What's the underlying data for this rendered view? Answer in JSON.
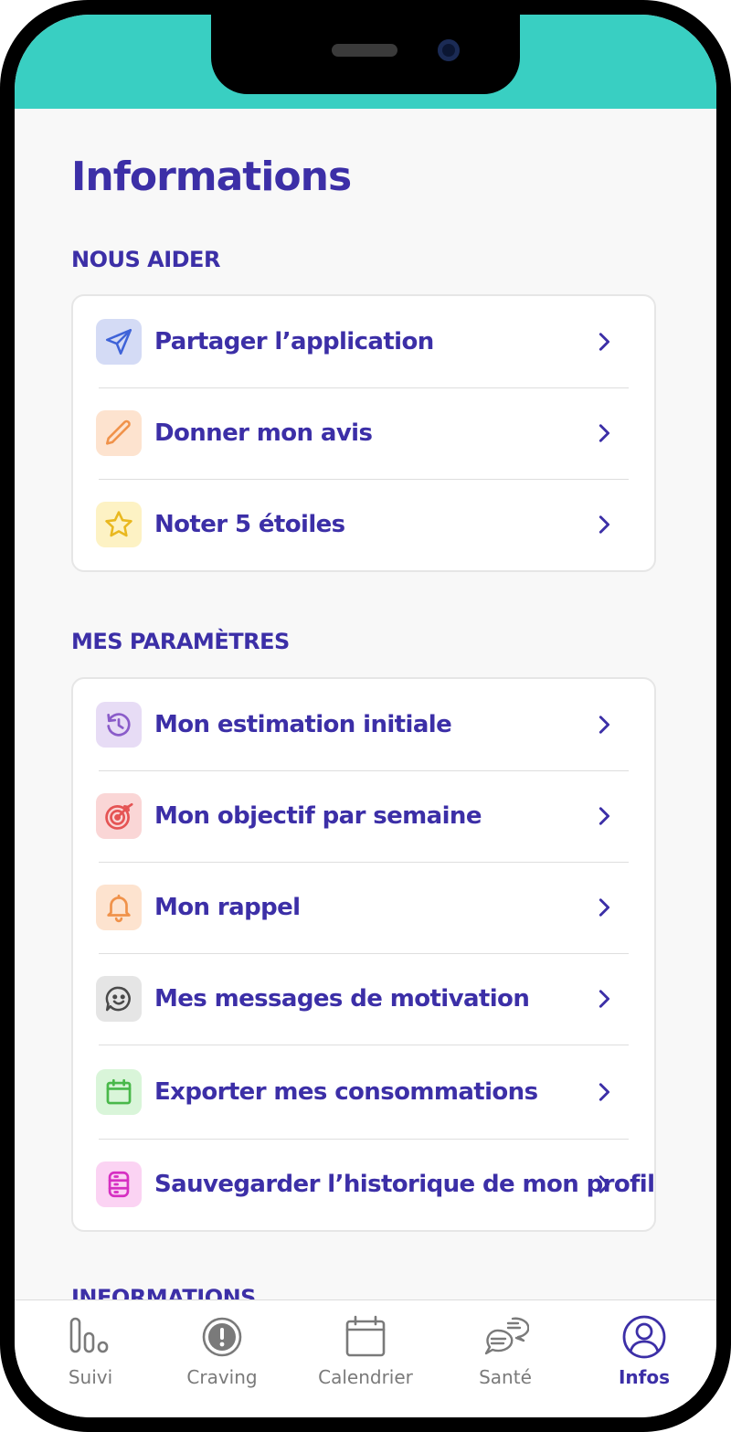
{
  "page": {
    "title": "Informations"
  },
  "sections": [
    {
      "title": "NOUS AIDER",
      "items": [
        {
          "label": "Partager l’application",
          "icon": "send-icon",
          "bg": "#d4dbf5",
          "color": "#3f63d8"
        },
        {
          "label": "Donner mon avis",
          "icon": "pencil-icon",
          "bg": "#fde3cf",
          "color": "#f0924a"
        },
        {
          "label": "Noter 5 étoiles",
          "icon": "star-icon",
          "bg": "#fdf2c4",
          "color": "#e9b81f"
        }
      ]
    },
    {
      "title": "MES PARAMÈTRES",
      "items": [
        {
          "label": "Mon estimation initiale",
          "icon": "history-icon",
          "bg": "#e7dcf5",
          "color": "#8a5cc9"
        },
        {
          "label": "Mon objectif par semaine",
          "icon": "target-icon",
          "bg": "#fad6d6",
          "color": "#e55454"
        },
        {
          "label": "Mon rappel",
          "icon": "bell-icon",
          "bg": "#fde3cf",
          "color": "#f0924a"
        },
        {
          "label": "Mes messages de motivation",
          "icon": "smile-chat-icon",
          "bg": "#e5e5e5",
          "color": "#4a4a4a"
        },
        {
          "label": "Exporter mes consommations",
          "icon": "calendar-icon",
          "bg": "#d9f5d9",
          "color": "#49b84a"
        },
        {
          "label": "Sauvegarder l’historique de mon profil",
          "icon": "database-icon",
          "bg": "#fbd3f3",
          "color": "#d62fc2"
        }
      ]
    }
  ],
  "next_section_title": "INFORMATIONS",
  "tab_bar": {
    "tabs": [
      {
        "label": "Suivi",
        "icon": "bar-chart-icon",
        "active": false
      },
      {
        "label": "Craving",
        "icon": "alert-circle-icon",
        "active": false
      },
      {
        "label": "Calendrier",
        "icon": "calendar-icon",
        "active": false
      },
      {
        "label": "Santé",
        "icon": "chat-bubbles-icon",
        "active": false
      },
      {
        "label": "Infos",
        "icon": "user-circle-icon",
        "active": true
      }
    ],
    "active_color": "#3c2fa7",
    "inactive_color": "#7a7a7a"
  },
  "colors": {
    "accent": "#3c2fa7",
    "status_bar": "#39cfc2"
  }
}
